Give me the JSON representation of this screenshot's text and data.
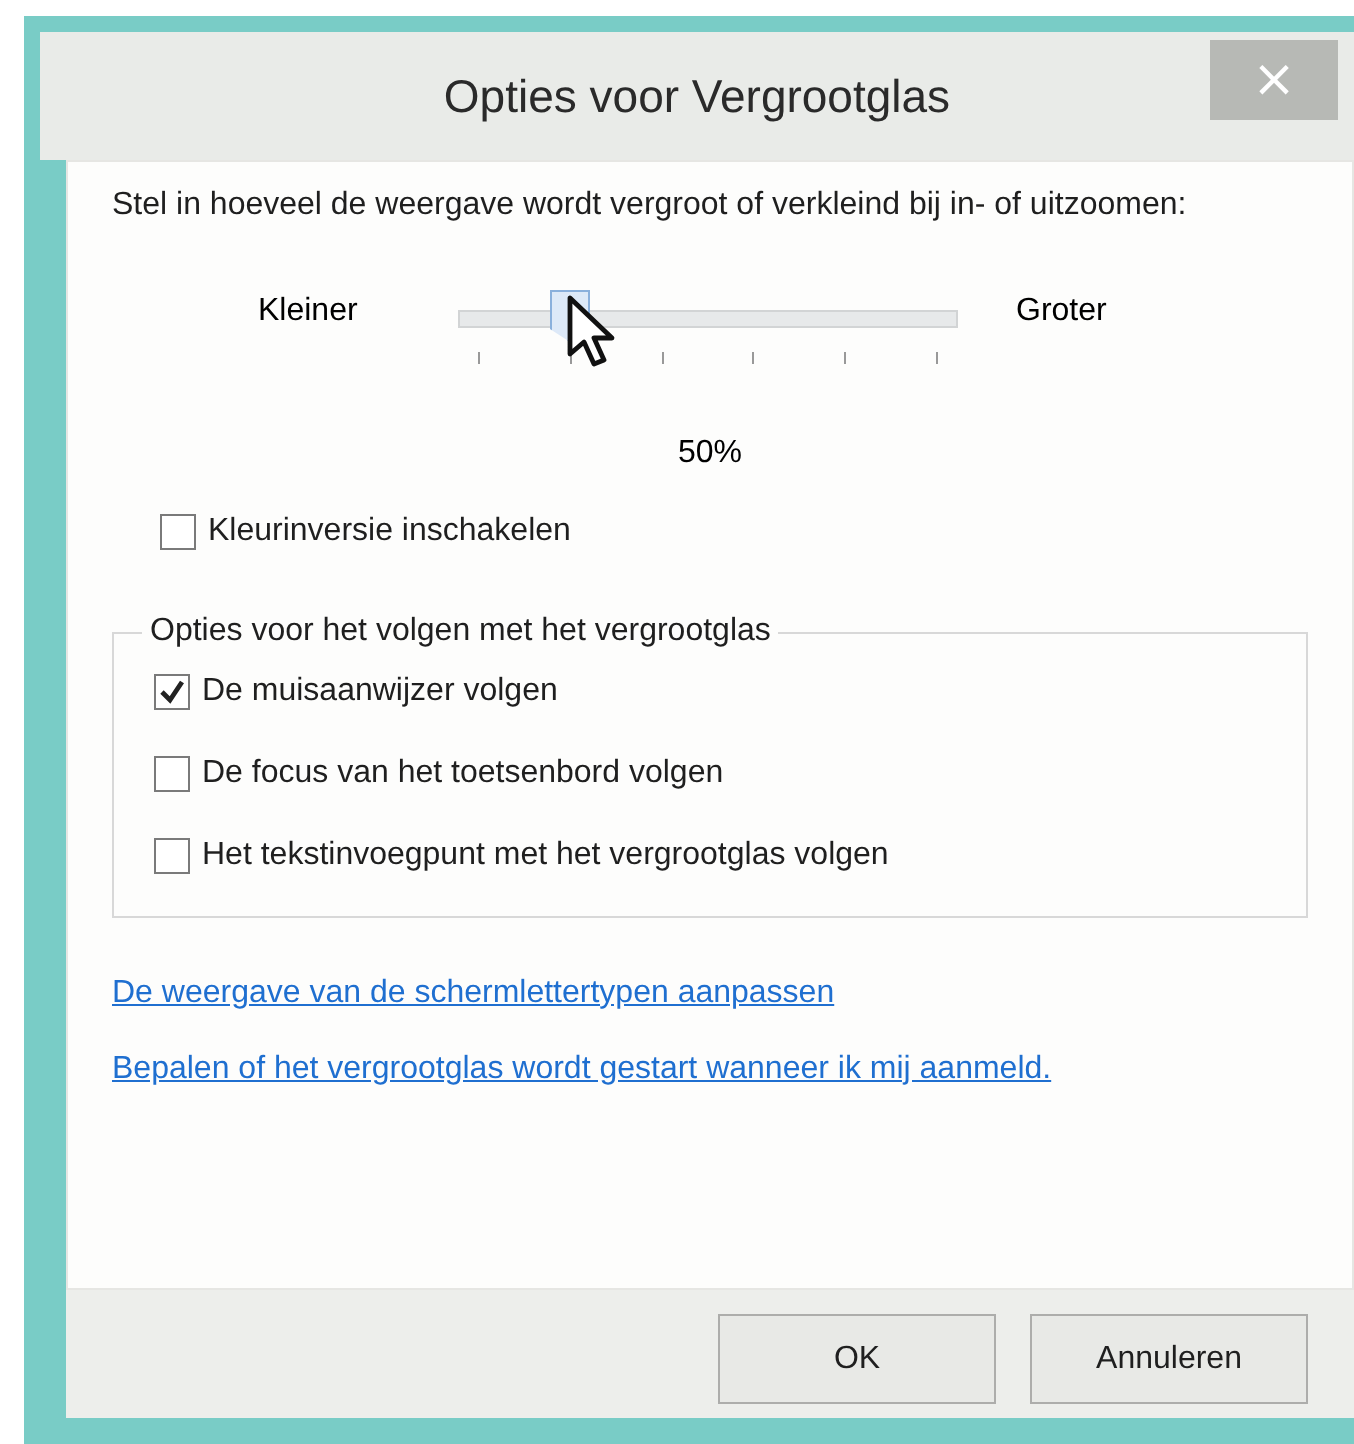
{
  "window": {
    "title": "Opties voor Vergrootglas",
    "close": "×"
  },
  "intro": "Stel in hoeveel de weergave wordt vergroot of verkleind bij in- of uitzoomen:",
  "slider": {
    "min_label": "Kleiner",
    "max_label": "Groter",
    "level": 0.2,
    "reading": "50%"
  },
  "invert": {
    "label": "Kleurinversie inschakelen",
    "checked": false
  },
  "tracking": {
    "title": "Opties voor het volgen met het vergrootglas",
    "options": [
      {
        "label": "De muisaanwijzer volgen",
        "checked": true
      },
      {
        "label": "De focus van het toetsenbord volgen",
        "checked": false
      },
      {
        "label": "Het tekstinvoegpunt met het vergrootglas volgen",
        "checked": false
      }
    ]
  },
  "links": [
    "De weergave van de schermlettertypen aanpassen",
    "Bepalen of het vergrootglas wordt gestart wanneer ik mij aanmeld."
  ],
  "buttons": [
    "OK",
    "Annuleren"
  ]
}
